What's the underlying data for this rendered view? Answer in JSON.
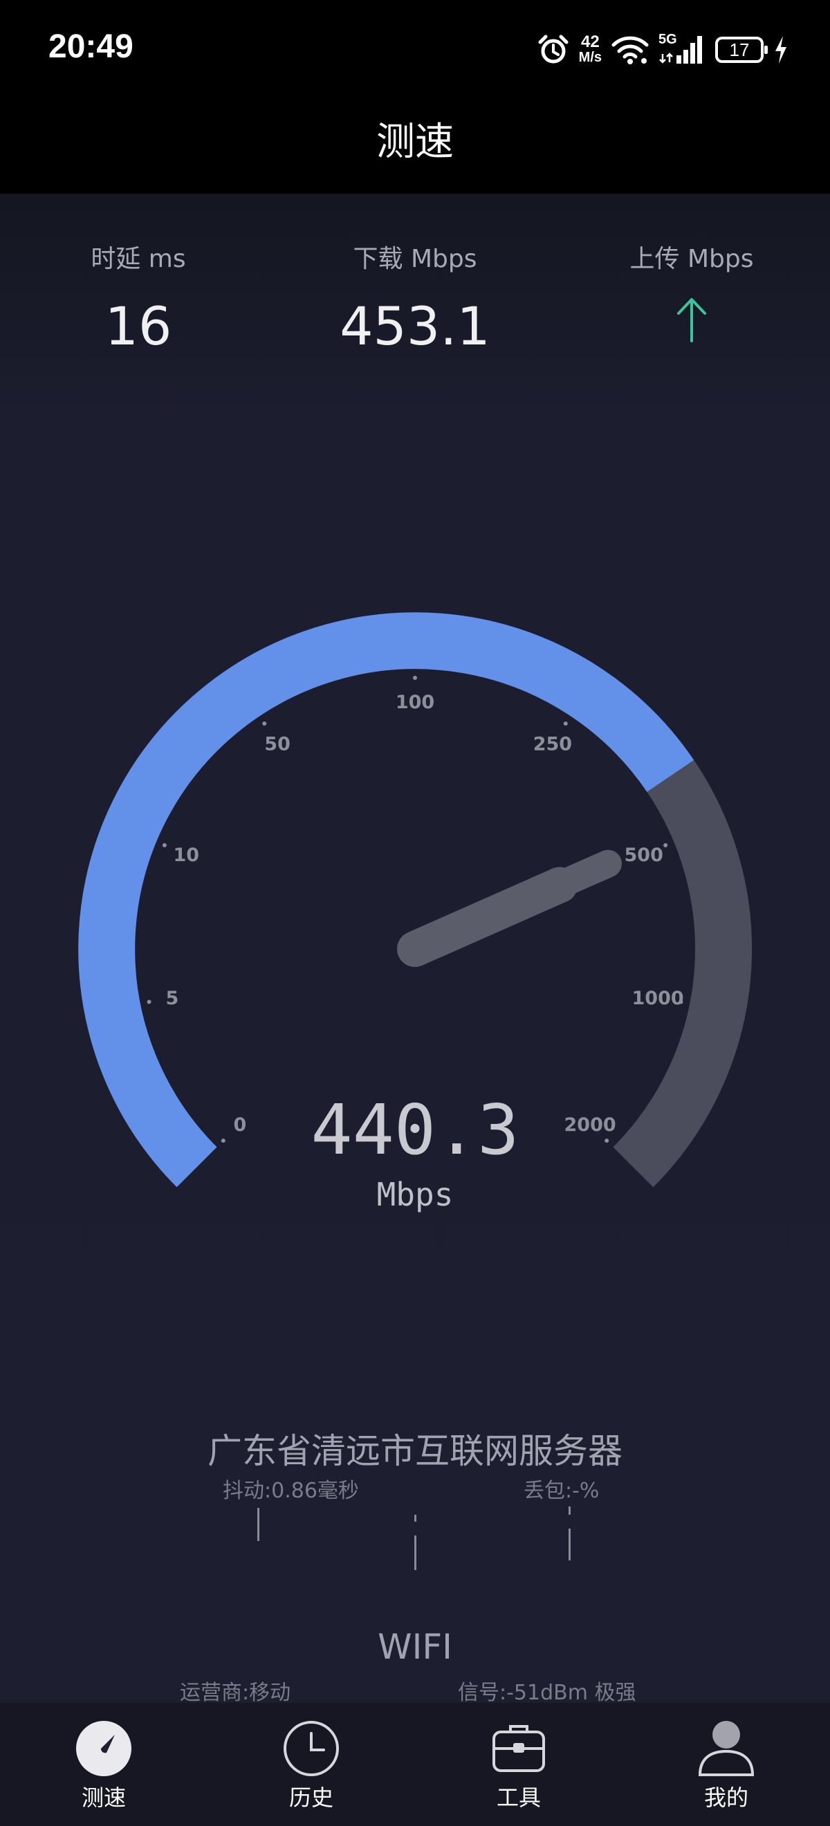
{
  "status_bar": {
    "time": "20:49",
    "net_speed_value": "42",
    "net_speed_unit": "M/s",
    "network": "5G",
    "battery": "17",
    "icons": [
      "alarm-icon",
      "wifi-icon",
      "cellular-signal-icon",
      "battery-icon",
      "charging-icon"
    ]
  },
  "header": {
    "title": "测速"
  },
  "metrics": {
    "latency_label": "时延 ms",
    "latency_value": "16",
    "download_label": "下载 Mbps",
    "download_value": "453.1",
    "upload_label": "上传 Mbps"
  },
  "gauge": {
    "reading": "440.3",
    "unit": "Mbps",
    "scale_labels": [
      "0",
      "5",
      "10",
      "50",
      "100",
      "250",
      "500",
      "1000",
      "2000"
    ],
    "progress_fraction": 0.707,
    "needle_fraction": 0.745,
    "progress_color": "#6390e8",
    "remaining_color": "#4b4c5c"
  },
  "server": {
    "name": "广东省清远市互联网服务器",
    "jitter": "抖动:0.86毫秒",
    "packet_loss": "丢包:-%"
  },
  "network_info": {
    "type": "WIFI",
    "carrier": "运营商:移动",
    "signal": "信号:-51dBm 极强"
  },
  "bottom_nav": [
    {
      "label": "测速",
      "icon": "speedometer-icon",
      "active": true
    },
    {
      "label": "历史",
      "icon": "clock-icon",
      "active": false
    },
    {
      "label": "工具",
      "icon": "toolbox-icon",
      "active": false
    },
    {
      "label": "我的",
      "icon": "person-icon",
      "active": false
    }
  ],
  "colors": {
    "accent": "#6390e8",
    "upload_arrow": "#3fc49a",
    "background": "#1d1e30"
  }
}
